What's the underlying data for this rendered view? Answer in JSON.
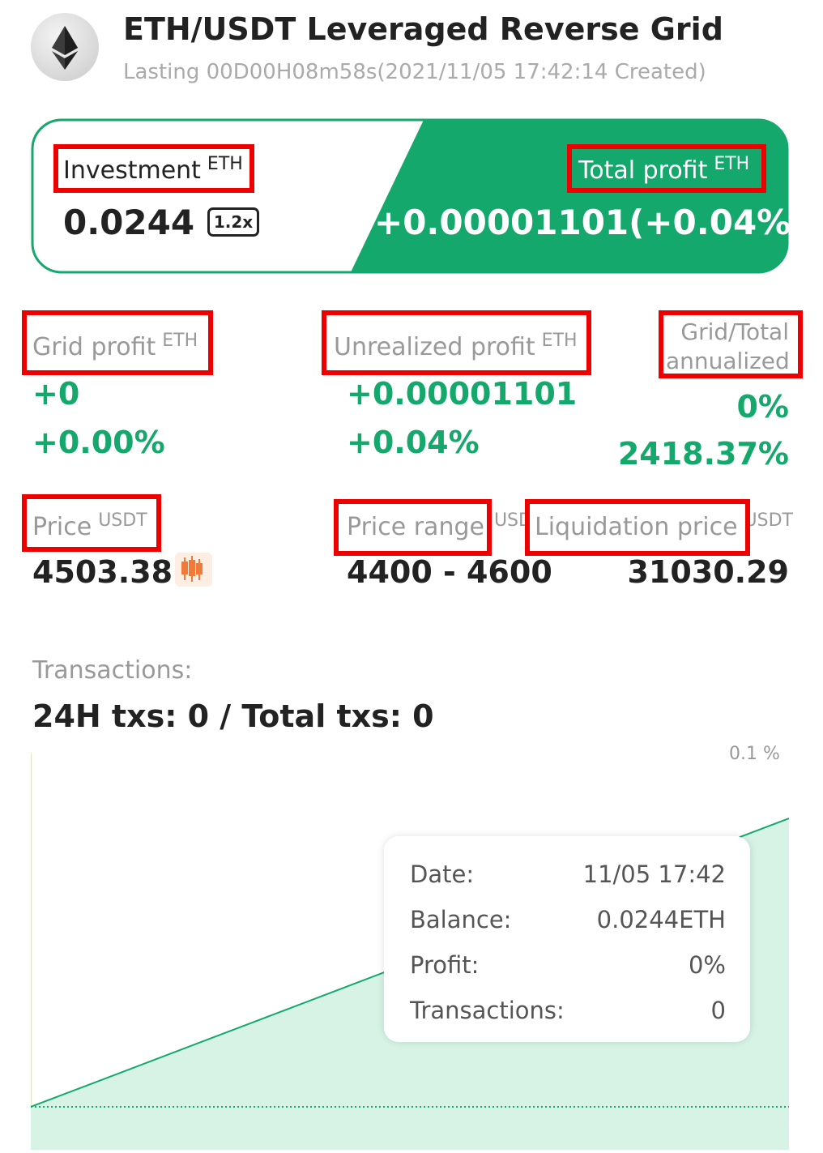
{
  "header": {
    "title": "ETH/USDT Leveraged Reverse Grid",
    "subtitle": "Lasting 00D00H08m58s(2021/11/05 17:42:14 Created)",
    "icon": "eth-icon"
  },
  "card": {
    "investment_label": "Investment",
    "investment_unit": "ETH",
    "investment_value": "0.0244",
    "leverage": "1.2x",
    "total_profit_label": "Total profit",
    "total_profit_unit": "ETH",
    "total_profit_value": "+0.00001101(+0.04%)"
  },
  "stats": {
    "grid_profit": {
      "label": "Grid profit",
      "unit": "ETH",
      "value": "+0",
      "percent": "+0.00%"
    },
    "unrealized_profit": {
      "label": "Unrealized profit",
      "unit": "ETH",
      "value": "+0.00001101",
      "percent": "+0.04%"
    },
    "annualized": {
      "label_line1": "Grid/Total",
      "label_line2": "annualized",
      "grid": "0%",
      "total": "2418.37%"
    },
    "price": {
      "label": "Price",
      "unit": "USDT",
      "value": "4503.38",
      "icon": "candlestick-chart-icon"
    },
    "price_range": {
      "label": "Price range",
      "unit": "USD",
      "value": "4400 - 4600"
    },
    "liquidation_price": {
      "label": "Liquidation price",
      "unit": "USDT",
      "value": "31030.29"
    }
  },
  "transactions": {
    "label": "Transactions:",
    "summary": "24H txs: 0 / Total txs: 0"
  },
  "chart_data": {
    "type": "area",
    "y_tick_label": "0.1 %",
    "grid": false,
    "series_color": "#14a86c"
  },
  "tooltip": {
    "rows": [
      {
        "label": "Date:",
        "value": "11/05 17:42"
      },
      {
        "label": "Balance:",
        "value": "0.0244ETH"
      },
      {
        "label": "Profit:",
        "value": "0%"
      },
      {
        "label": "Transactions:",
        "value": "0"
      }
    ]
  },
  "colors": {
    "accent_green": "#14a86c",
    "highlight_red": "#ee0000",
    "chart_fill": "#d6f3e6"
  }
}
